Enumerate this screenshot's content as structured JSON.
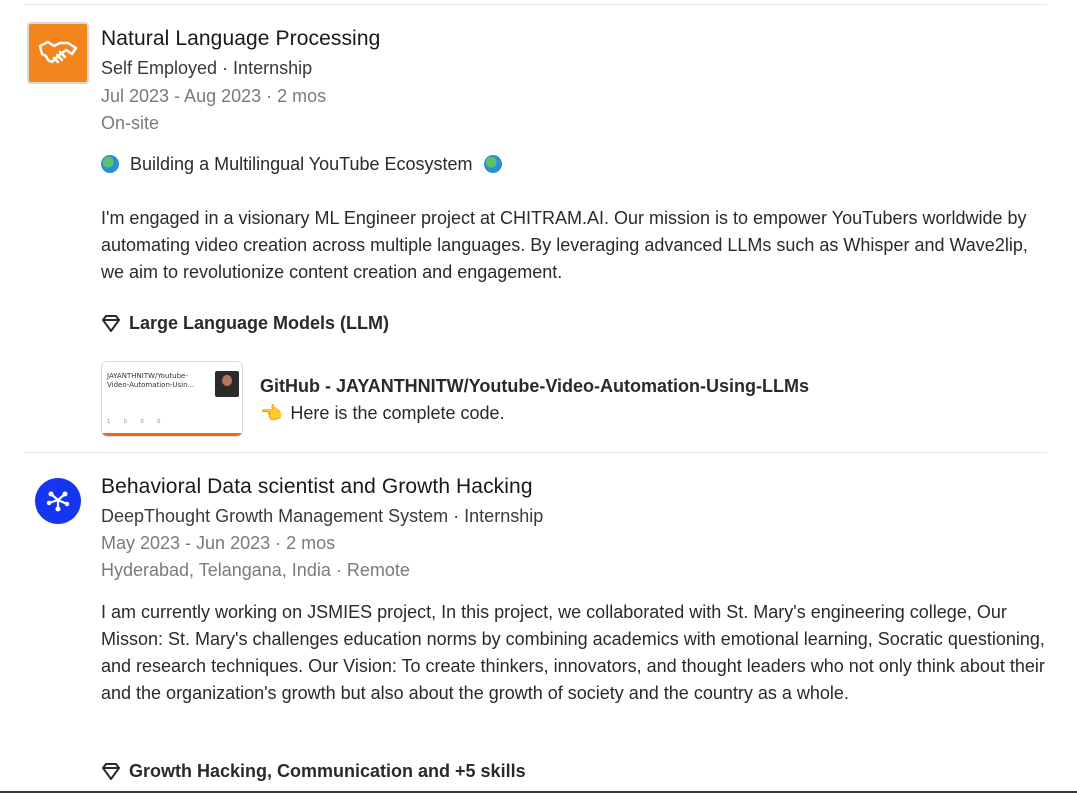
{
  "entries": [
    {
      "title": "Natural Language Processing",
      "company_line": "Self Employed · Internship",
      "dates": "Jul 2023 - Aug 2023 · 2 mos",
      "location": "On-site",
      "headline": "Building a Multilingual YouTube Ecosystem",
      "description": "I'm engaged in a visionary ML Engineer project at CHITRAM.AI. Our mission is to empower YouTubers worldwide by automating video creation across multiple languages. By leveraging advanced LLMs such as Whisper and Wave2lip, we aim to revolutionize content creation and engagement.",
      "skills": "Large Language Models (LLM)",
      "media": {
        "thumb_text": "JAYANTHNITW/Youtube-Video-Automation-Usin...",
        "thumb_stats": "1  0  0  0",
        "title": "GitHub - JAYANTHNITW/Youtube-Video-Automation-Using-LLMs",
        "description": "Here is the complete code."
      }
    },
    {
      "title": "Behavioral Data scientist and Growth Hacking",
      "company_line": "DeepThought Growth Management System · Internship",
      "dates": "May 2023 - Jun 2023 · 2 mos",
      "location": "Hyderabad, Telangana, India · Remote",
      "description": "I am currently working on JSMIES project, In this project, we collaborated with St. Mary's engineering college, Our Misson: St. Mary's challenges education norms by combining academics with emotional learning, Socratic questioning, and research techniques. Our Vision: To create thinkers, innovators, and thought leaders who not only think about their and the organization's growth but also about the growth of society and the country as a whole.",
      "skills": "Growth Hacking, Communication and +5 skills"
    }
  ],
  "icons": {
    "nlp_logo": "handshake-icon",
    "dt_logo": "network-icon",
    "skill": "diamond-icon",
    "globe": "globe-icon",
    "pointing": "pointing-hand-icon"
  },
  "colors": {
    "nlp_logo_bg": "#f2861d",
    "dt_logo_bg": "#1535f0",
    "muted_text": "#7a7a7a"
  }
}
